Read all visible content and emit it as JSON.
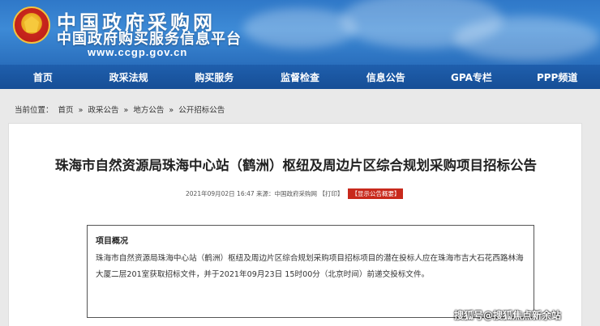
{
  "header": {
    "title": "中国政府采购网",
    "subtitle": "中国政府购买服务信息平台",
    "url": "www.ccgp.gov.cn"
  },
  "nav": {
    "items": [
      "首页",
      "政采法规",
      "购买服务",
      "监督检查",
      "信息公告",
      "GPA专栏",
      "PPP频道"
    ]
  },
  "breadcrumb": {
    "label": "当前位置：",
    "items": [
      "首页",
      "»",
      "政采公告",
      "»",
      "地方公告",
      "»",
      "公开招标公告"
    ]
  },
  "article": {
    "title": "珠海市自然资源局珠海中心站（鹤洲）枢纽及周边片区综合规划采购项目招标公告",
    "meta": "2021年09月02日 16:47 来源：中国政府采购网 【打印】",
    "summary_button": "【显示公告概要】",
    "overview_title": "项目概况",
    "overview_text": "珠海市自然资源局珠海中心站（鹤洲）枢纽及周边片区综合规划采购项目招标项目的潜在投标人应在珠海市吉大石花西路林海大厦二层201室获取招标文件，并于2021年09月23日 15时00分（北京时间）前递交投标文件。"
  },
  "watermark": "搜狐号@搜狐焦点新余站",
  "colors": {
    "banner": "#2f78c8",
    "nav": "#1b56a2",
    "accent_red": "#c8291c"
  }
}
